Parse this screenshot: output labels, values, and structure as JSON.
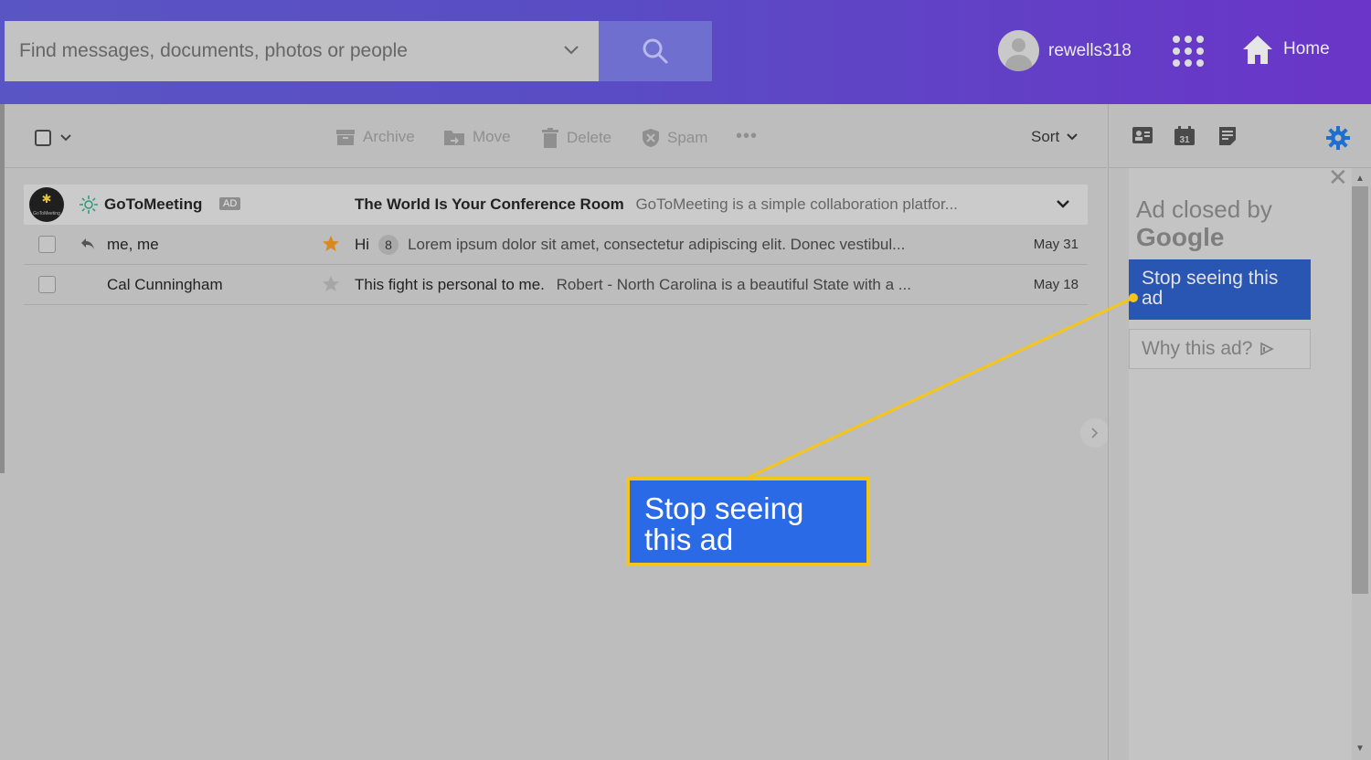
{
  "header": {
    "search_placeholder": "Find messages, documents, photos or people",
    "username": "rewells318",
    "home_label": "Home"
  },
  "toolbar": {
    "archive": "Archive",
    "move": "Move",
    "delete": "Delete",
    "spam": "Spam",
    "more": "•••",
    "sort": "Sort"
  },
  "messages": {
    "ad": {
      "logo_text": "GoToMeeting",
      "sender": "GoToMeeting",
      "badge": "AD",
      "subject": "The World Is Your Conference Room",
      "snippet": "GoToMeeting is a simple collaboration platfor..."
    },
    "rows": [
      {
        "sender": "me, me",
        "subject": "Hi",
        "count": "8",
        "snippet": "Lorem ipsum dolor sit amet, consectetur adipiscing elit. Donec vestibul...",
        "date": "May 31",
        "starred": true
      },
      {
        "sender": "Cal Cunningham",
        "subject": "This fight is personal to me.",
        "snippet": "Robert - North Carolina is a beautiful State with a ...",
        "date": "May 18",
        "starred": false
      }
    ]
  },
  "ad_panel": {
    "closed_by": "Ad closed by",
    "google": "Google",
    "stop_button": "Stop seeing this ad",
    "why_button": "Why this ad?"
  },
  "callout": {
    "text": "Stop seeing this ad"
  },
  "colors": {
    "header_start": "#5a55c4",
    "header_end": "#6a35c8",
    "stop_button": "#2a56b3",
    "callout_bg": "#2a6ae6",
    "callout_border": "#f5c518",
    "star": "#d98a1f",
    "settings": "#1e6fd0"
  }
}
